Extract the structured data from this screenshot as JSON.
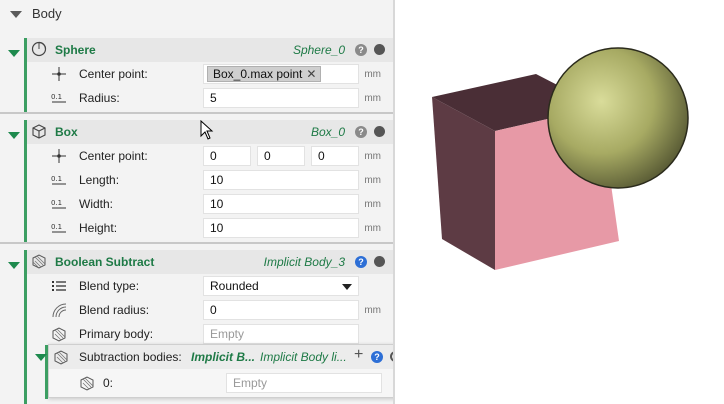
{
  "body_section": {
    "title": "Body"
  },
  "sphere": {
    "title": "Sphere",
    "alias": "Sphere_0",
    "help": "?",
    "center_point": {
      "label": "Center point:",
      "value": "Box_0.max point",
      "remove": "✕",
      "unit": "mm"
    },
    "radius": {
      "label": "Radius:",
      "value": "5",
      "unit": "mm"
    }
  },
  "box": {
    "title": "Box",
    "alias": "Box_0",
    "help": "?",
    "center_point": {
      "label": "Center point:",
      "x": "0",
      "y": "0",
      "z": "0",
      "unit": "mm"
    },
    "length": {
      "label": "Length:",
      "value": "10",
      "unit": "mm"
    },
    "width": {
      "label": "Width:",
      "value": "10",
      "unit": "mm"
    },
    "height": {
      "label": "Height:",
      "value": "10",
      "unit": "mm"
    }
  },
  "boolean": {
    "title": "Boolean Subtract",
    "alias": "Implicit Body_3",
    "help": "?",
    "blend_type": {
      "label": "Blend type:",
      "value": "Rounded"
    },
    "blend_radius": {
      "label": "Blend radius:",
      "value": "0",
      "unit": "mm"
    },
    "primary_body": {
      "label": "Primary body:",
      "placeholder": "Empty"
    },
    "subtraction": {
      "title": "Subtraction bodies:",
      "value": "Implicit B...",
      "alias": "Implicit Body li...",
      "add": "+",
      "help": "?",
      "item": {
        "label": "0:",
        "placeholder": "Empty"
      }
    }
  },
  "colors": {
    "accent_green": "#1e7a46",
    "help_blue": "#2d6fd6",
    "box_front": "#e799a6",
    "box_side": "#5e3c44",
    "sphere": "#b6b878"
  },
  "viewport": {
    "objects": [
      "box",
      "sphere"
    ]
  }
}
